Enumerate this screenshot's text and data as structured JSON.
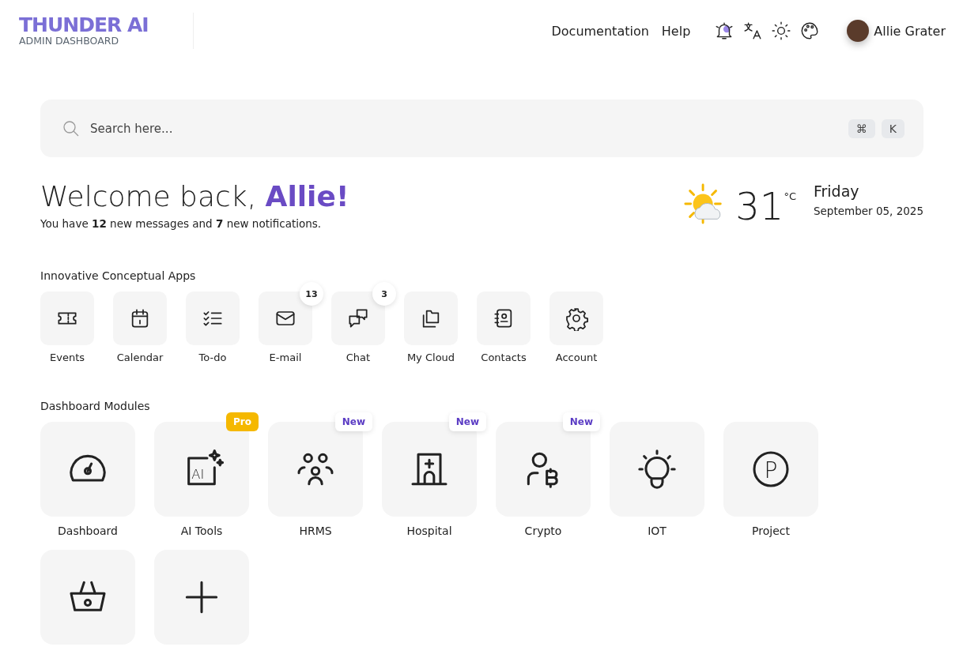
{
  "brand": {
    "logo": "THUNDER AI",
    "subtitle": "ADMIN DASHBOARD"
  },
  "nav_links": [
    "Documentation",
    "Help"
  ],
  "header_icons": [
    {
      "kind": "bell",
      "unread": true
    },
    {
      "kind": "translate"
    },
    {
      "kind": "sun"
    },
    {
      "kind": "palette"
    }
  ],
  "user": {
    "name": "Allie Grater"
  },
  "search": {
    "placeholder": "Search here...",
    "shortcut": [
      "⌘",
      "K"
    ]
  },
  "welcome": {
    "greeting": "Welcome back,",
    "name": "Allie!",
    "message": "You have **12** new messages and **7** new notifications."
  },
  "weather": {
    "temperature": "31",
    "unit": "°C",
    "day": "Friday",
    "date": "September 05, 2025"
  },
  "apps_title": "Innovative Conceptual Apps",
  "apps": [
    {
      "label": "Events",
      "kind": "ticket"
    },
    {
      "label": "Calendar",
      "kind": "calendar"
    },
    {
      "label": "To-do",
      "kind": "todo"
    },
    {
      "label": "E-mail",
      "kind": "mail",
      "count": "13"
    },
    {
      "label": "Chat",
      "kind": "chat",
      "count": "3"
    },
    {
      "label": "My Cloud",
      "kind": "folders"
    },
    {
      "label": "Contacts",
      "kind": "contacts"
    },
    {
      "label": "Account",
      "kind": "gear"
    }
  ],
  "modules_title": "Dashboard Modules",
  "modules": [
    {
      "label": "Dashboard",
      "kind": "gauge"
    },
    {
      "label": "AI Tools",
      "kind": "ai",
      "glyph": "AI",
      "badge": {
        "text": "Pro",
        "kind": "pro"
      }
    },
    {
      "label": "HRMS",
      "kind": "people",
      "badge": {
        "text": "New",
        "kind": "new"
      }
    },
    {
      "label": "Hospital",
      "kind": "hospital",
      "badge": {
        "text": "New",
        "kind": "new"
      }
    },
    {
      "label": "Crypto",
      "kind": "crypto",
      "badge": {
        "text": "New",
        "kind": "new"
      }
    },
    {
      "label": "IOT",
      "kind": "bulb"
    },
    {
      "label": "Project",
      "kind": "project",
      "glyph": "P"
    },
    {
      "kind": "basket"
    },
    {
      "kind": "plus"
    }
  ]
}
